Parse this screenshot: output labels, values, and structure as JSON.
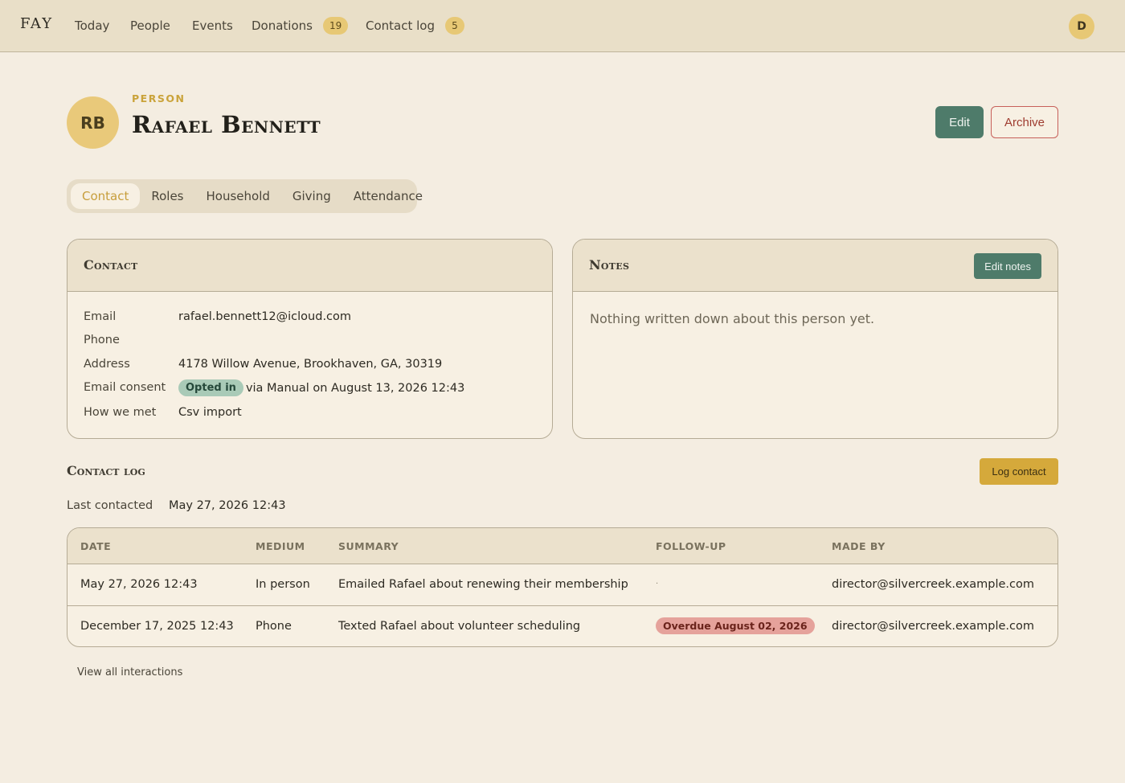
{
  "nav": {
    "logo": "FAY",
    "items": [
      {
        "label": "Today"
      },
      {
        "label": "People"
      },
      {
        "label": "Events"
      },
      {
        "label": "Donations",
        "badge": "19"
      },
      {
        "label": "Contact log",
        "badge": "5"
      }
    ],
    "user_initial": "D"
  },
  "header": {
    "initials": "RB",
    "eyebrow": "PERSON",
    "name": "Rafael Bennett",
    "edit_label": "Edit",
    "archive_label": "Archive"
  },
  "tabs": [
    "Contact",
    "Roles",
    "Household",
    "Giving",
    "Attendance"
  ],
  "contact": {
    "title": "Contact",
    "rows": [
      {
        "label": "Email",
        "value": "rafael.bennett12@icloud.com"
      },
      {
        "label": "Phone",
        "value": ""
      },
      {
        "label": "Address",
        "value": "4178 Willow Avenue, Brookhaven, GA, 30319"
      },
      {
        "label": "Email consent",
        "pill": "Opted in",
        "value": "via Manual on August 13, 2026 12:43"
      },
      {
        "label": "How we met",
        "value": "Csv import"
      }
    ]
  },
  "notes": {
    "title": "Notes",
    "edit_label": "Edit notes",
    "empty_text": "Nothing written down about this person yet."
  },
  "log": {
    "title": "Contact log",
    "button_label": "Log contact",
    "last_contacted_label": "Last contacted",
    "last_contacted_value": "May 27, 2026 12:43",
    "columns": [
      "DATE",
      "MEDIUM",
      "SUMMARY",
      "FOLLOW-UP",
      "MADE BY"
    ],
    "rows": [
      {
        "date": "May 27, 2026 12:43",
        "medium": "In person",
        "summary": "Emailed Rafael about renewing their membership",
        "followup": "·",
        "made_by": "director@silvercreek.example.com"
      },
      {
        "date": "December 17, 2025 12:43",
        "medium": "Phone",
        "summary": "Texted Rafael about volunteer scheduling",
        "followup_pill": "Overdue August 02, 2026",
        "made_by": "director@silvercreek.example.com"
      }
    ],
    "view_all": "View all interactions"
  }
}
